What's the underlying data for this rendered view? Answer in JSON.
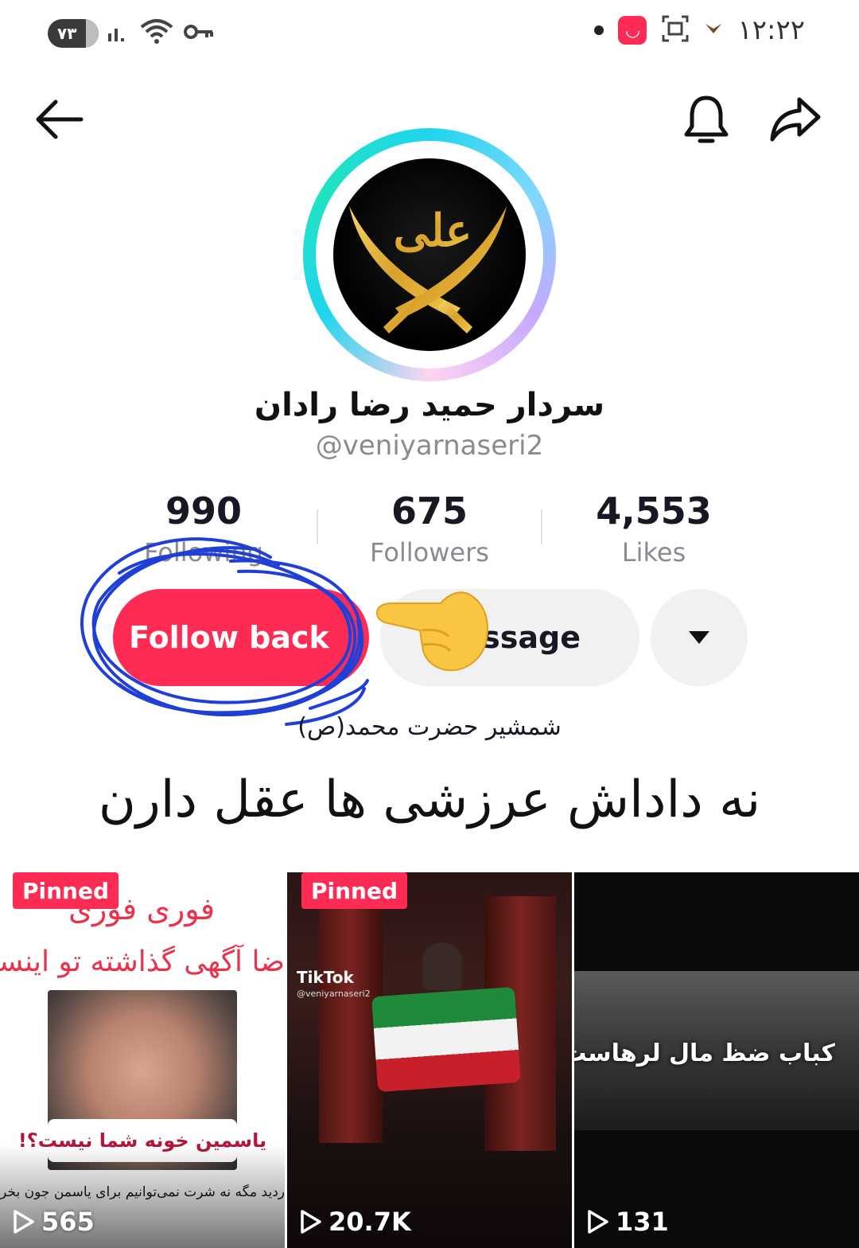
{
  "status_bar": {
    "battery": "۷۳",
    "time": "۱۲:۲۲"
  },
  "profile": {
    "display_name": "سردار حمید رضا رادان",
    "username": "@veniyarnaseri2",
    "avatar_text": "علی",
    "bio": "شمشیر حضرت محمد(ص)"
  },
  "stats": [
    {
      "value": "990",
      "label": "Following"
    },
    {
      "value": "675",
      "label": "Followers"
    },
    {
      "value": "4,553",
      "label": "Likes"
    }
  ],
  "buttons": {
    "follow_back": "Follow back",
    "message": "ssage"
  },
  "caption": "نه داداش عرزشی ها عقل دارن",
  "videos": [
    {
      "pinned": "Pinned",
      "views": "565",
      "overlay_title": "فوری فوری",
      "overlay_line": "ضا آگهی گذاشته تو اینست",
      "overlay_sticker": "یاسمین خونه شما نیست؟!",
      "overlay_caption": "ردید مگه نه شرت نمی‌توانیم برای  یاسمن جون بخر"
    },
    {
      "pinned": "Pinned",
      "views": "20.7K",
      "watermark": "TikTok",
      "watermark_user": "@veniyarnaseri2"
    },
    {
      "views": "131",
      "overlay_caption": "کباب ضظ مال لرهاست"
    }
  ],
  "colors": {
    "accent": "#fe2c55",
    "button_gray": "#f1f1f2",
    "scribble": "#1f3fd6"
  }
}
